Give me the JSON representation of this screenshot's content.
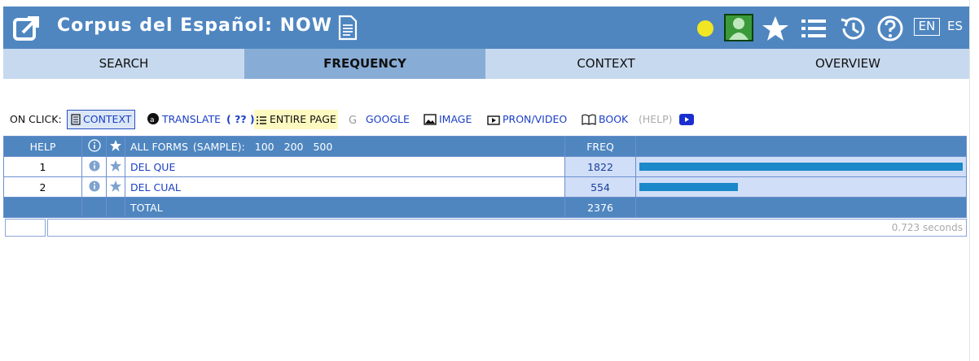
{
  "header": {
    "title": "Corpus del Español: NOW",
    "lang_en": "EN",
    "lang_es": "ES",
    "colors": {
      "bar": "#4f86c0",
      "dot": "#f0e623",
      "user": "#3a9a3a"
    },
    "icons": [
      "external-link-icon",
      "document-icon",
      "status-dot-icon",
      "user-icon",
      "star-icon",
      "list-icon",
      "history-icon",
      "help-icon"
    ]
  },
  "tabs": [
    {
      "label": "SEARCH"
    },
    {
      "label": "FREQUENCY",
      "active": true
    },
    {
      "label": "CONTEXT"
    },
    {
      "label": "OVERVIEW"
    }
  ],
  "on_click": {
    "label": "ON CLICK:",
    "context": "CONTEXT",
    "translate": "TRANSLATE",
    "translate_q": "( ?? )",
    "entire_page": "ENTIRE PAGE",
    "google": "GOOGLE",
    "image": "IMAGE",
    "pron_video": "PRON/VIDEO",
    "book": "BOOK",
    "help": "(HELP)"
  },
  "table": {
    "headers": {
      "help": "HELP",
      "all_forms": "ALL FORMS",
      "sample_label": "(SAMPLE):",
      "sample_options": [
        "100",
        "200",
        "500"
      ],
      "freq": "FREQ"
    },
    "rows": [
      {
        "num": "1",
        "word": "DEL QUE",
        "freq": "1822",
        "ratio": 1.0
      },
      {
        "num": "2",
        "word": "DEL CUAL",
        "freq": "554",
        "ratio": 0.304
      }
    ],
    "total_label": "TOTAL",
    "total_freq": "2376"
  },
  "footer": {
    "timing": "0.723 seconds"
  }
}
